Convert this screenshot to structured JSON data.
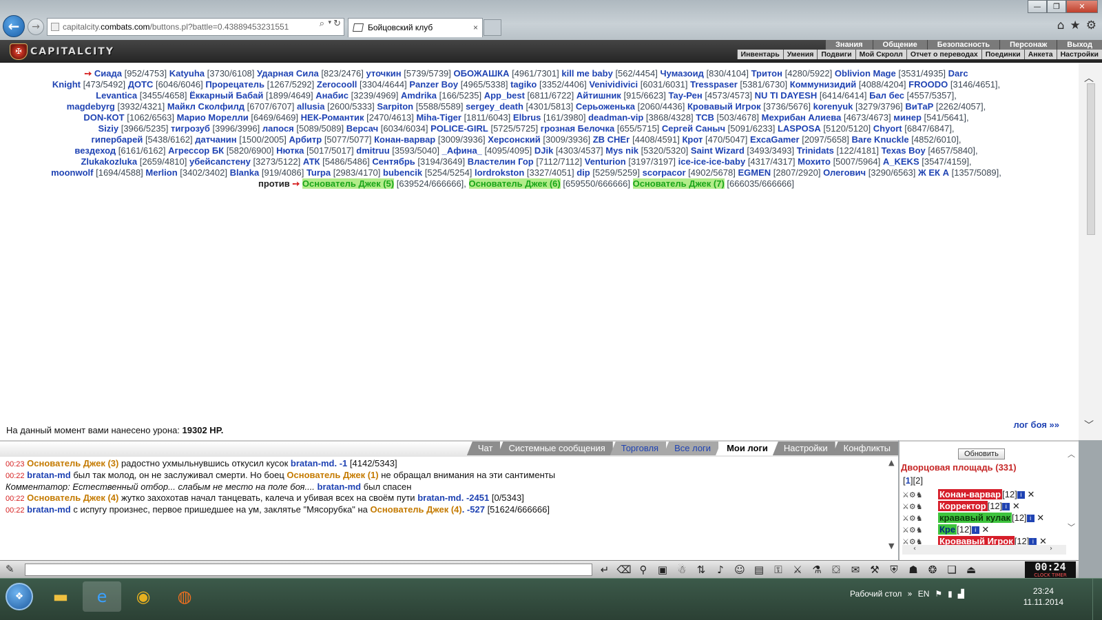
{
  "browser": {
    "url_host": "capitalcity.",
    "url_domain": "combats.com",
    "url_path": "/buttons.pl?battle=0.43889453231551",
    "tab_title": "Бойцовский клуб",
    "back_icon": "back-arrow-icon",
    "forward_icon": "forward-arrow-icon",
    "tab_close": "×",
    "min": "—",
    "max": "❐",
    "close": "✕"
  },
  "game": {
    "logo": "CAPITALCITY",
    "top_menu": [
      "Знания",
      "Общение",
      "Безопасность",
      "Персонаж",
      "Выход"
    ],
    "bottom_menu": [
      "Инвентарь",
      "Умения",
      "Подвиги",
      "Мой Скролл",
      "Отчет о переводах",
      "Поединки",
      "Анкета",
      "Настройки"
    ]
  },
  "battle": {
    "rows": [
      [
        [
          "Сиада",
          "[952/4753]"
        ],
        [
          "Katyuha",
          "[3730/6108]"
        ],
        [
          "Ударная Сила",
          "[823/2476]"
        ],
        [
          "уточкин",
          "[5739/5739]"
        ],
        [
          "ОБОЖАШКА",
          "[4961/7301]"
        ],
        [
          "kill me baby",
          "[562/4454]"
        ],
        [
          "Чумазоид",
          "[830/4104]"
        ],
        [
          "Тритон",
          "[4280/5922]"
        ],
        [
          "Oblivion Mage",
          "[3531/4935]"
        ],
        [
          "Darc",
          ""
        ]
      ],
      [
        [
          "Knight",
          "[473/5492]"
        ],
        [
          "ДОТС",
          "[6046/6046]"
        ],
        [
          "Прорецатель",
          "[1267/5292]"
        ],
        [
          "Zerocooll",
          "[3304/4644]"
        ],
        [
          "Panzer Boy",
          "[4965/5338]"
        ],
        [
          "tagiko",
          "[3352/4406]"
        ],
        [
          "Venividivici",
          "[6031/6031]"
        ],
        [
          "Tresspaser",
          "[5381/6730]"
        ],
        [
          "Коммунизидий",
          "[4088/4204]"
        ],
        [
          "FROODO",
          "[3146/4651],"
        ]
      ],
      [
        [
          "Levantica",
          "[3455/4658]"
        ],
        [
          "Ёккарный Бабай",
          "[1899/4649]"
        ],
        [
          "Анабис",
          "[3239/4969]"
        ],
        [
          "Amdrika",
          "[166/5235]"
        ],
        [
          "App_best",
          "[6811/6722]"
        ],
        [
          "Айтишник",
          "[915/6623]"
        ],
        [
          "Tay-Рен",
          "[4573/4573]"
        ],
        [
          "NU TI DAYESH",
          "[6414/6414]"
        ],
        [
          "Бал бес",
          "[4557/5357],"
        ]
      ],
      [
        [
          "magdebyrg",
          "[3932/4321]"
        ],
        [
          "Майкл Сколфилд",
          "[6707/6707]"
        ],
        [
          "allusia",
          "[2600/5333]"
        ],
        [
          "Sarpiton",
          "[5588/5589]"
        ],
        [
          "sergey_death",
          "[4301/5813]"
        ],
        [
          "Серьоженька",
          "[2060/4436]"
        ],
        [
          "Кровавый Игрок",
          "[3736/5676]"
        ],
        [
          "korenyuk",
          "[3279/3796]"
        ],
        [
          "ВиТаР",
          "[2262/4057],"
        ]
      ],
      [
        [
          "DON-КОТ",
          "[1062/6563]"
        ],
        [
          "Марио Морелли",
          "[6469/6469]"
        ],
        [
          "НЕК-Романтик",
          "[2470/4613]"
        ],
        [
          "Miha-Tiger",
          "[1811/6043]"
        ],
        [
          "Elbrus",
          "[161/3980]"
        ],
        [
          "deadman-vip",
          "[3868/4328]"
        ],
        [
          "ТСВ",
          "[503/4678]"
        ],
        [
          "Мехрибан Алиева",
          "[4673/4673]"
        ],
        [
          "минер",
          "[541/5641],"
        ]
      ],
      [
        [
          "Siziy",
          "[3966/5235]"
        ],
        [
          "тигрозуб",
          "[3996/3996]"
        ],
        [
          "лапося",
          "[5089/5089]"
        ],
        [
          "Версач",
          "[6034/6034]"
        ],
        [
          "POLICE-GIRL",
          "[5725/5725]"
        ],
        [
          "грозная Белочка",
          "[655/5715]"
        ],
        [
          "Сергей Саныч",
          "[5091/6233]"
        ],
        [
          "LASPOSA",
          "[5120/5120]"
        ],
        [
          "Chyort",
          "[6847/6847],"
        ]
      ],
      [
        [
          "гипербарей",
          "[5438/6162]"
        ],
        [
          "датчанин",
          "[1500/2005]"
        ],
        [
          "Арбитр",
          "[5077/5077]"
        ],
        [
          "Конан-варвар",
          "[3009/3936]"
        ],
        [
          "Херсонский",
          "[3009/3936]"
        ],
        [
          "ZB СНЕг",
          "[4408/4591]"
        ],
        [
          "Крот",
          "[470/5047]"
        ],
        [
          "ExcaGamer",
          "[2097/5658]"
        ],
        [
          "Bare Knuckle",
          "[4852/6010],"
        ]
      ],
      [
        [
          "вездеход",
          "[6161/6162]"
        ],
        [
          "Агрессор БК",
          "[5820/6900]"
        ],
        [
          "Нютка",
          "[5017/5017]"
        ],
        [
          "dmitruu",
          "[3593/5040]"
        ],
        [
          "_Афина_",
          "[4095/4095]"
        ],
        [
          "DJik",
          "[4303/4537]"
        ],
        [
          "Mys nik",
          "[5320/5320]"
        ],
        [
          "Saint Wizard",
          "[3493/3493]"
        ],
        [
          "Trinidats",
          "[122/4181]"
        ],
        [
          "Texas Boy",
          "[4657/5840],"
        ]
      ],
      [
        [
          "Zlukakozluka",
          "[2659/4810]"
        ],
        [
          "убейсапстену",
          "[3273/5122]"
        ],
        [
          "АТК",
          "[5486/5486]"
        ],
        [
          "Сентябрь",
          "[3194/3649]"
        ],
        [
          "Властелин Гор",
          "[7112/7112]"
        ],
        [
          "Venturion",
          "[3197/3197]"
        ],
        [
          "ice-ice-ice-baby",
          "[4317/4317]"
        ],
        [
          "Мохито",
          "[5007/5964]"
        ],
        [
          "A_KEKS",
          "[3547/4159],"
        ]
      ],
      [
        [
          "moonwolf",
          "[1694/4588]"
        ],
        [
          "Merlion",
          "[3402/3402]"
        ],
        [
          "Blanka",
          "[919/4086]"
        ],
        [
          "Turpa",
          "[2983/4170]"
        ],
        [
          "bubencik",
          "[5254/5254]"
        ],
        [
          "lordrokston",
          "[3327/4051]"
        ],
        [
          "dip",
          "[5259/5259]"
        ],
        [
          "scorpacor",
          "[4902/5678]"
        ],
        [
          "EGMEN",
          "[2807/2920]"
        ],
        [
          "Олегович",
          "[3290/6563]"
        ],
        [
          "Ж ЕК А",
          "[1357/5089],"
        ]
      ]
    ],
    "vs": "против",
    "boss": [
      [
        "Основатель Джек (5)",
        "[639524/666666],"
      ],
      [
        "Основатель Джек (6)",
        "[659550/666666]"
      ],
      [
        "Основатель Джек (7)",
        "[666035/666666]"
      ]
    ],
    "damage_label": "На данный момент вами нанесено урона:",
    "damage_value": "19302 HP.",
    "log_link": "лог боя »»"
  },
  "log_tabs": [
    "Чат",
    "Системные сообщения",
    "Торговля",
    "Все логи",
    "Мои логи",
    "Настройки",
    "Конфликты"
  ],
  "log": [
    {
      "t": "00:23",
      "a": "Основатель Джек (3)",
      "m": " радостно ухмыльнувшись откусил кусок ",
      "b": "bratan-md",
      "d": ". -1",
      "r": " [4142/5343]"
    },
    {
      "t": "00:22",
      "a": "bratan-md",
      "m": " был так молод, он не заслуживал смерти. Но боец ",
      "b": "Основатель Джек (1)",
      "d": "",
      "r": " не обращал внимания на эти сантименты"
    },
    {
      "t": "",
      "a": "",
      "m": "Комментатор: Естественный отбор... слабым не место на поле боя.... ",
      "b": "bratan-md",
      "d": "",
      "r": " был спасен"
    },
    {
      "t": "00:22",
      "a": "Основатель Джек (4)",
      "m": " жутко захохотав начал танцевать, калеча и убивая всех на своём пути ",
      "b": "bratan-md",
      "d": ". -2451",
      "r": " [0/5343]"
    },
    {
      "t": "00:22",
      "a": "bratan-md",
      "m": " с испугу произнес, первое пришедшее на ум, заклятье \"Мясорубка\" на ",
      "b": "Основатель Джек (4)",
      "d": ". -527",
      "r": " [51624/666666]"
    }
  ],
  "right": {
    "refresh": "Обновить",
    "title": "Дворцовая площадь (331)",
    "pages": [
      "1",
      "2"
    ],
    "players": [
      {
        "n": "Конан-варвар",
        "l": "[12]",
        "c": "r"
      },
      {
        "n": "Корректор",
        "l": "[12]",
        "c": "r"
      },
      {
        "n": "крававый кулак",
        "l": "[12]",
        "c": "g"
      },
      {
        "n": "Кре",
        "l": "[12]",
        "c": "g2"
      },
      {
        "n": "Кровавый Игрок",
        "l": "[12]",
        "c": "r"
      }
    ]
  },
  "chat": {
    "clock": "00:24",
    "clock_sub": "CLOCK TIMER"
  },
  "taskbar": {
    "desktop": "Рабочий стол",
    "lang": "EN",
    "time": "23:24",
    "date": "11.11.2014"
  }
}
